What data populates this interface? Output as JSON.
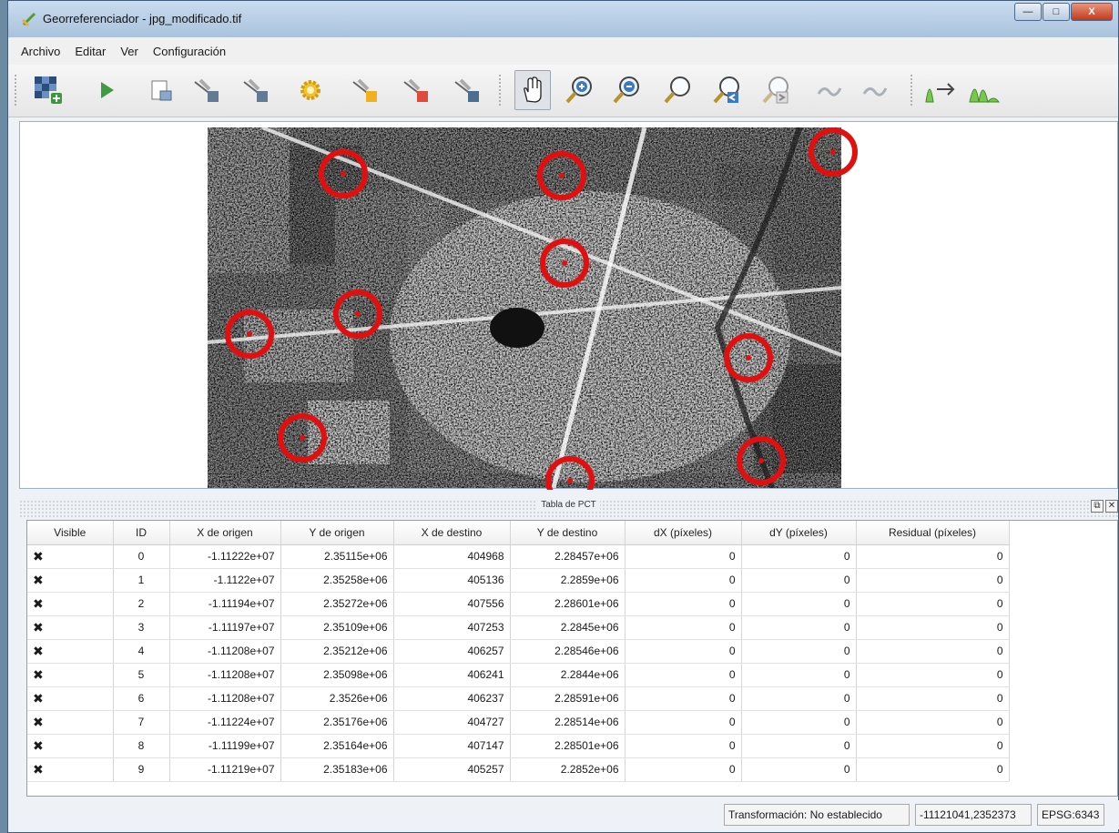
{
  "window": {
    "title": "Georreferenciador - jpg_modificado.tif",
    "controls": {
      "minimize": "—",
      "maximize": "□",
      "close": "X"
    }
  },
  "menu": [
    "Archivo",
    "Editar",
    "Ver",
    "Configuración"
  ],
  "toolbar": {
    "icons": [
      "open-raster-icon",
      "start-georeferencing-icon",
      "generate-gdal-script-icon",
      "load-gcp-points-icon",
      "save-gcp-points-icon",
      "transformation-settings-icon",
      "add-point-icon",
      "delete-point-icon",
      "move-gcp-point-icon",
      "pan-icon",
      "zoom-in-icon",
      "zoom-out-icon",
      "zoom-to-layer-icon",
      "zoom-last-icon",
      "zoom-next-icon",
      "link-georeferencer-icon",
      "link-qgis-icon",
      "full-histogram-stretch-icon",
      "local-histogram-stretch-icon"
    ],
    "active_tool": "pan-icon"
  },
  "gcp_dock": {
    "title": "Tabla de PCT",
    "float_button": "⧉",
    "close_button": "✕",
    "columns": [
      "Visible",
      "ID",
      "X de origen",
      "Y de origen",
      "X de destino",
      "Y de destino",
      "dX (píxeles)",
      "dY (píxeles)",
      "Residual (píxeles)"
    ],
    "rows": [
      {
        "visible": "✖",
        "id": "0",
        "x_origen": "-1.11222e+07",
        "y_origen": "2.35115e+06",
        "x_destino": "404968",
        "y_destino": "2.28457e+06",
        "dx": "0",
        "dy": "0",
        "residual": "0"
      },
      {
        "visible": "✖",
        "id": "1",
        "x_origen": "-1.1122e+07",
        "y_origen": "2.35258e+06",
        "x_destino": "405136",
        "y_destino": "2.2859e+06",
        "dx": "0",
        "dy": "0",
        "residual": "0"
      },
      {
        "visible": "✖",
        "id": "2",
        "x_origen": "-1.11194e+07",
        "y_origen": "2.35272e+06",
        "x_destino": "407556",
        "y_destino": "2.28601e+06",
        "dx": "0",
        "dy": "0",
        "residual": "0"
      },
      {
        "visible": "✖",
        "id": "3",
        "x_origen": "-1.11197e+07",
        "y_origen": "2.35109e+06",
        "x_destino": "407253",
        "y_destino": "2.2845e+06",
        "dx": "0",
        "dy": "0",
        "residual": "0"
      },
      {
        "visible": "✖",
        "id": "4",
        "x_origen": "-1.11208e+07",
        "y_origen": "2.35212e+06",
        "x_destino": "406257",
        "y_destino": "2.28546e+06",
        "dx": "0",
        "dy": "0",
        "residual": "0"
      },
      {
        "visible": "✖",
        "id": "5",
        "x_origen": "-1.11208e+07",
        "y_origen": "2.35098e+06",
        "x_destino": "406241",
        "y_destino": "2.2844e+06",
        "dx": "0",
        "dy": "0",
        "residual": "0"
      },
      {
        "visible": "✖",
        "id": "6",
        "x_origen": "-1.11208e+07",
        "y_origen": "2.3526e+06",
        "x_destino": "406237",
        "y_destino": "2.28591e+06",
        "dx": "0",
        "dy": "0",
        "residual": "0"
      },
      {
        "visible": "✖",
        "id": "7",
        "x_origen": "-1.11224e+07",
        "y_origen": "2.35176e+06",
        "x_destino": "404727",
        "y_destino": "2.28514e+06",
        "dx": "0",
        "dy": "0",
        "residual": "0"
      },
      {
        "visible": "✖",
        "id": "8",
        "x_origen": "-1.11199e+07",
        "y_origen": "2.35164e+06",
        "x_destino": "407147",
        "y_destino": "2.28501e+06",
        "dx": "0",
        "dy": "0",
        "residual": "0"
      },
      {
        "visible": "✖",
        "id": "9",
        "x_origen": "-1.11219e+07",
        "y_origen": "2.35183e+06",
        "x_destino": "405257",
        "y_destino": "2.2852e+06",
        "dx": "0",
        "dy": "0",
        "residual": "0"
      }
    ]
  },
  "status": {
    "transformation": "Transformación: No establecido",
    "coordinates": "-11121041,2352373",
    "crs": "EPSG:6343"
  },
  "colors": {
    "gcp_marker": "#e01010",
    "selection_accent": "#9aa6b2"
  }
}
